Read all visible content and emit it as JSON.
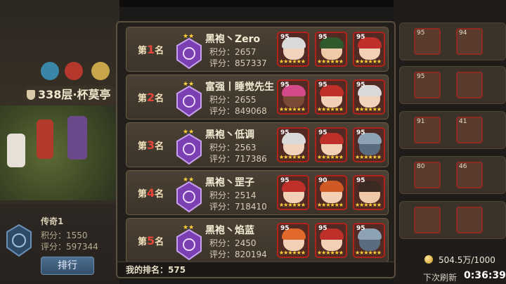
{
  "left_panel": {
    "level_text": "338层·杯莫亭",
    "legend_name": "传奇1",
    "legend_score": "积分：1550",
    "legend_rating": "评分：597344",
    "rank_button": "排行"
  },
  "leaderboard": {
    "rows": [
      {
        "prefix": "第",
        "num": "1",
        "suffix": "名",
        "name": "黑袍丶Zero",
        "score": "积分：2657",
        "rating": "评分：857337",
        "heroes": [
          {
            "level": "95",
            "hair": "#d9d9d9",
            "face": "#f1d3bd"
          },
          {
            "level": "95",
            "hair": "#2e5a2c",
            "face": "#f0c9a8"
          },
          {
            "level": "95",
            "hair": "#c0302a",
            "face": "#f3cfb6"
          }
        ]
      },
      {
        "prefix": "第",
        "num": "2",
        "suffix": "名",
        "name": "富强丨睡觉先生",
        "score": "积分：2655",
        "rating": "评分：849068",
        "heroes": [
          {
            "level": "95",
            "hair": "#d24a8a",
            "face": "#7a4a36"
          },
          {
            "level": "95",
            "hair": "#c0302a",
            "face": "#f3cfb6"
          },
          {
            "level": "95",
            "hair": "#d9d9d9",
            "face": "#f1d3bd"
          }
        ]
      },
      {
        "prefix": "第",
        "num": "3",
        "suffix": "名",
        "name": "黑袍丶低调",
        "score": "积分：2563",
        "rating": "评分：717386",
        "heroes": [
          {
            "level": "95",
            "hair": "#d9d9d9",
            "face": "#f1d3bd"
          },
          {
            "level": "95",
            "hair": "#c0302a",
            "face": "#f3cfb6"
          },
          {
            "level": "95",
            "hair": "#8ea2b6",
            "face": "#5a6c80"
          }
        ]
      },
      {
        "prefix": "第",
        "num": "4",
        "suffix": "名",
        "name": "黑袍丶罡子",
        "score": "积分：2514",
        "rating": "评分：718410",
        "heroes": [
          {
            "level": "95",
            "hair": "#c0302a",
            "face": "#f3cfb6"
          },
          {
            "level": "90",
            "hair": "#cf5a26",
            "face": "#f3cfb6"
          },
          {
            "level": "95",
            "hair": "#3b2a22",
            "face": "#f0c9a8"
          }
        ]
      },
      {
        "prefix": "第",
        "num": "5",
        "suffix": "名",
        "name": "黑袍丶焰蓝",
        "score": "积分：2450",
        "rating": "评分：820194",
        "heroes": [
          {
            "level": "95",
            "hair": "#e0682a",
            "face": "#f3cfb6"
          },
          {
            "level": "95",
            "hair": "#c0302a",
            "face": "#f3cfb6"
          },
          {
            "level": "95",
            "hair": "#8ea2b6",
            "face": "#5a6c80"
          }
        ]
      }
    ],
    "my_rank": "我的排名：575"
  },
  "right_panel": {
    "levels": [
      "95",
      "94",
      "95",
      "91",
      "41",
      "80",
      "46"
    ],
    "coins": "504.5万/1000",
    "refresh_label": "下次刷新",
    "refresh_time": "0:36:39"
  },
  "colors": {
    "rank_number": "#e8463a",
    "hero_border": "#b1221b",
    "star": "#ffd23a",
    "crest": "#7a3fb0"
  },
  "icons": [
    "crest-icon",
    "star-icon",
    "coin-icon",
    "medal-icon"
  ]
}
